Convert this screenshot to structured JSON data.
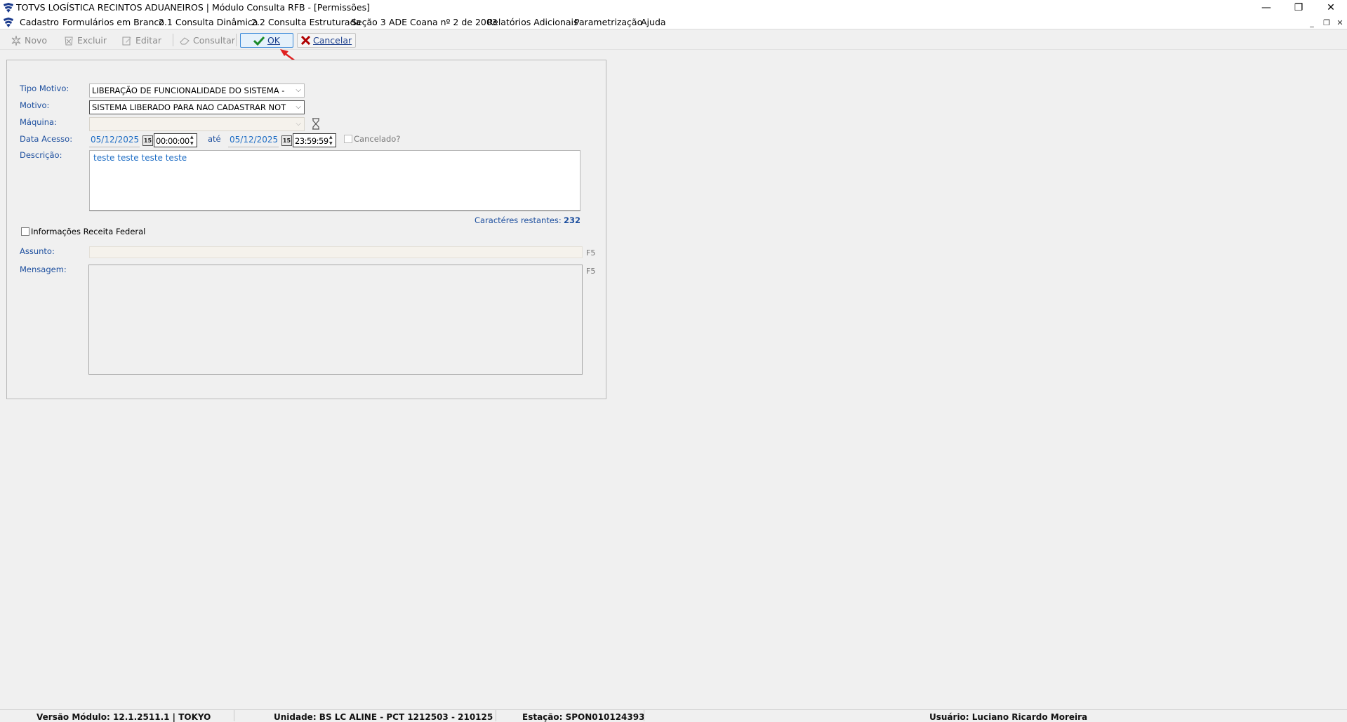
{
  "window": {
    "title": "TOTVS LOGÍSTICA RECINTOS ADUANEIROS | Módulo Consulta RFB - [Permissões]",
    "minimize": "—",
    "maximize": "❐",
    "close": "✕"
  },
  "menu": {
    "items": [
      "Cadastro",
      "Formulários em Branco",
      "2.1 Consulta Dinâmica",
      "2.2 Consulta Estruturada",
      "Seção 3",
      "ADE Coana nº 2 de 2003",
      "Relatórios Adicionais",
      "Parametrização",
      "Ajuda"
    ]
  },
  "toolbar": {
    "novo": "Novo",
    "excluir": "Excluir",
    "editar": "Editar",
    "consultar": "Consultar",
    "ok": "OK",
    "cancelar": "Cancelar"
  },
  "form": {
    "tipo_motivo_label": "Tipo Motivo:",
    "tipo_motivo_value": "LIBERAÇÃO DE FUNCIONALIDADE DO SISTEMA -",
    "motivo_label": "Motivo:",
    "motivo_value": "SISTEMA LIBERADO PARA NAO CADASTRAR NOT",
    "maquina_label": "Máquina:",
    "maquina_value": "",
    "data_acesso_label": "Data Acesso:",
    "date_from": "05/12/2025",
    "time_from": "00:00:00",
    "ate_label": "até",
    "date_to": "05/12/2025",
    "time_to": "23:59:59",
    "cancelado_label": "Cancelado?",
    "descricao_label": "Descrição:",
    "descricao_value": "teste teste teste teste",
    "caracteres_label": "Caractéres restantes:",
    "caracteres_value": "232",
    "info_receita_label": "Informações Receita Federal",
    "assunto_label": "Assunto:",
    "assunto_f5": "F5",
    "mensagem_label": "Mensagem:",
    "mensagem_f5": "F5",
    "calendar_glyph": "15"
  },
  "status": {
    "versao": "Versão Módulo:  12.1.2511.1  |  TOKYO",
    "unidade": "Unidade: BS LC ALINE - PCT 1212503 - 210125",
    "estacao": "Estação: SPON010124393",
    "usuario": "Usuário: Luciano Ricardo Moreira"
  },
  "colors": {
    "accent": "#1c4e9e",
    "ok_check": "#1a8a2a",
    "cancel_x": "#b00000",
    "annotation_arrow": "#e02020"
  }
}
